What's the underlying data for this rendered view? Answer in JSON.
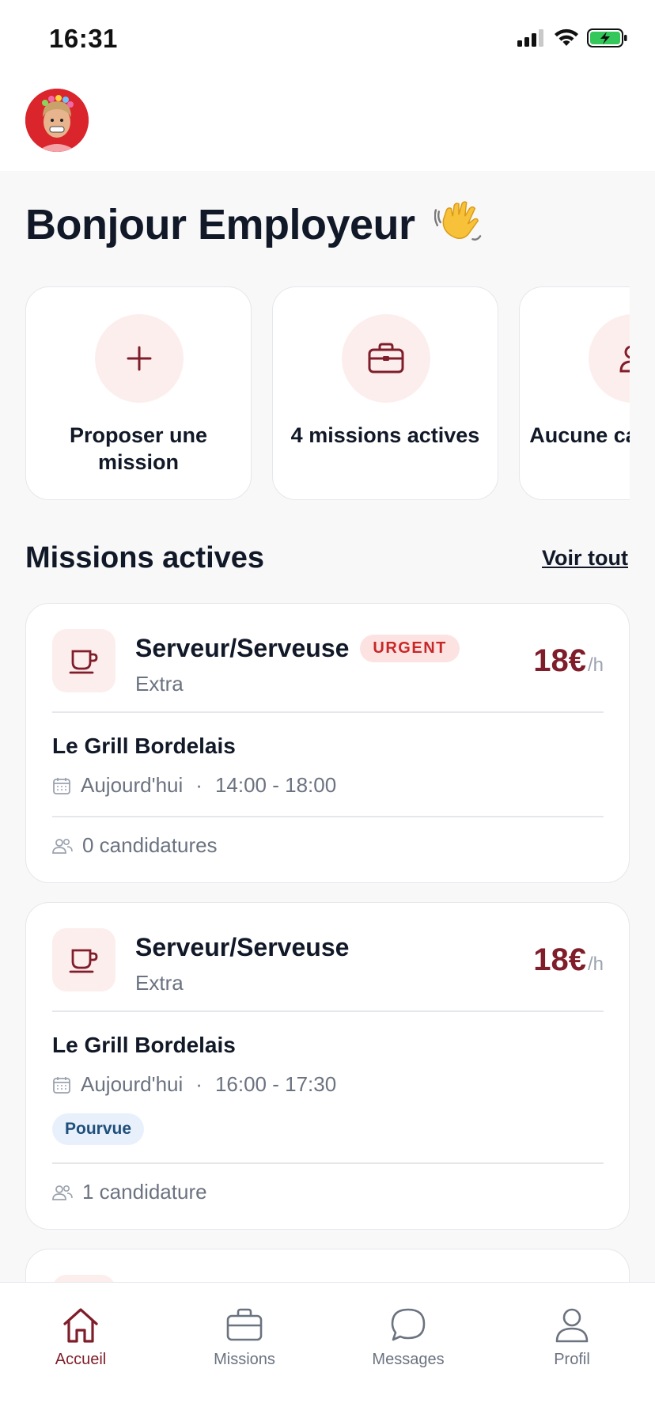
{
  "status_bar": {
    "time": "16:31"
  },
  "header": {
    "avatar_alt": "avatar"
  },
  "greeting": {
    "text": "Bonjour Employeur"
  },
  "quick_actions": [
    {
      "label": "Proposer une mission",
      "icon": "plus-icon"
    },
    {
      "label": "4 missions actives",
      "icon": "briefcase-icon"
    },
    {
      "label": "Aucune candidature",
      "icon": "user-icon"
    }
  ],
  "section": {
    "title": "Missions actives",
    "see_all": "Voir tout"
  },
  "missions": [
    {
      "title": "Serveur/Serveuse",
      "badge": "URGENT",
      "type": "Extra",
      "price": "18€",
      "unit": "/h",
      "company": "Le Grill Bordelais",
      "day": "Aujourd'hui",
      "hours": "14:00 - 18:00",
      "applications": "0 candidatures"
    },
    {
      "title": "Serveur/Serveuse",
      "type": "Extra",
      "price": "18€",
      "unit": "/h",
      "company": "Le Grill Bordelais",
      "day": "Aujourd'hui",
      "hours": "16:00 - 17:30",
      "status": "Pourvue",
      "applications": "1 candidature"
    }
  ],
  "tabs": [
    {
      "label": "Accueil",
      "icon": "home-icon",
      "active": true
    },
    {
      "label": "Missions",
      "icon": "briefcase-icon",
      "active": false
    },
    {
      "label": "Messages",
      "icon": "chat-bubble-icon",
      "active": false
    },
    {
      "label": "Profil",
      "icon": "person-icon",
      "active": false
    }
  ],
  "colors": {
    "accent": "#7f1d2a",
    "accent_soft": "#fdeeee",
    "urgent_text": "#c62828",
    "urgent_bg": "#fde2e2",
    "filled_bg": "#e8f1fb",
    "filled_text": "#1f4f7a"
  }
}
